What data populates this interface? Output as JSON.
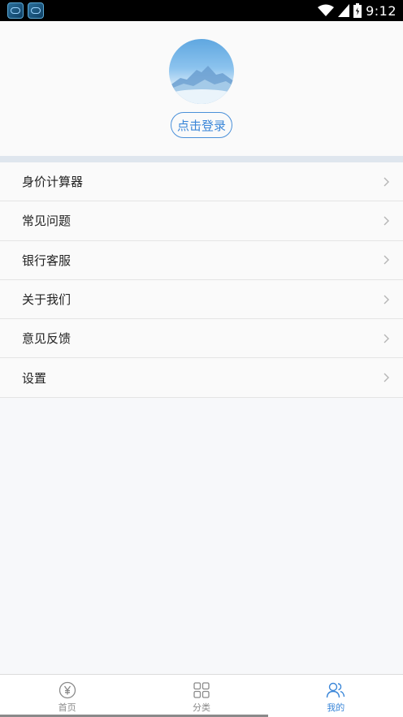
{
  "status_bar": {
    "time": "9:12",
    "app_icons": [
      "app-notification-icon",
      "app-notification-icon"
    ]
  },
  "profile": {
    "login_label": "点击登录",
    "avatar_icon": "mountain-avatar-icon"
  },
  "menu": {
    "items": [
      {
        "label": "身价计算器",
        "name": "menu-item-net-worth-calculator"
      },
      {
        "label": "常见问题",
        "name": "menu-item-faq"
      },
      {
        "label": "银行客服",
        "name": "menu-item-bank-service"
      },
      {
        "label": "关于我们",
        "name": "menu-item-about-us"
      },
      {
        "label": "意见反馈",
        "name": "menu-item-feedback"
      },
      {
        "label": "设置",
        "name": "menu-item-settings"
      }
    ]
  },
  "tabbar": {
    "tabs": [
      {
        "label": "首页",
        "icon": "yen-icon",
        "active": false
      },
      {
        "label": "分类",
        "icon": "grid-icon",
        "active": false
      },
      {
        "label": "我的",
        "icon": "users-icon",
        "active": true
      }
    ]
  },
  "colors": {
    "accent": "#3a86d8",
    "band": "#dfe6ee"
  }
}
